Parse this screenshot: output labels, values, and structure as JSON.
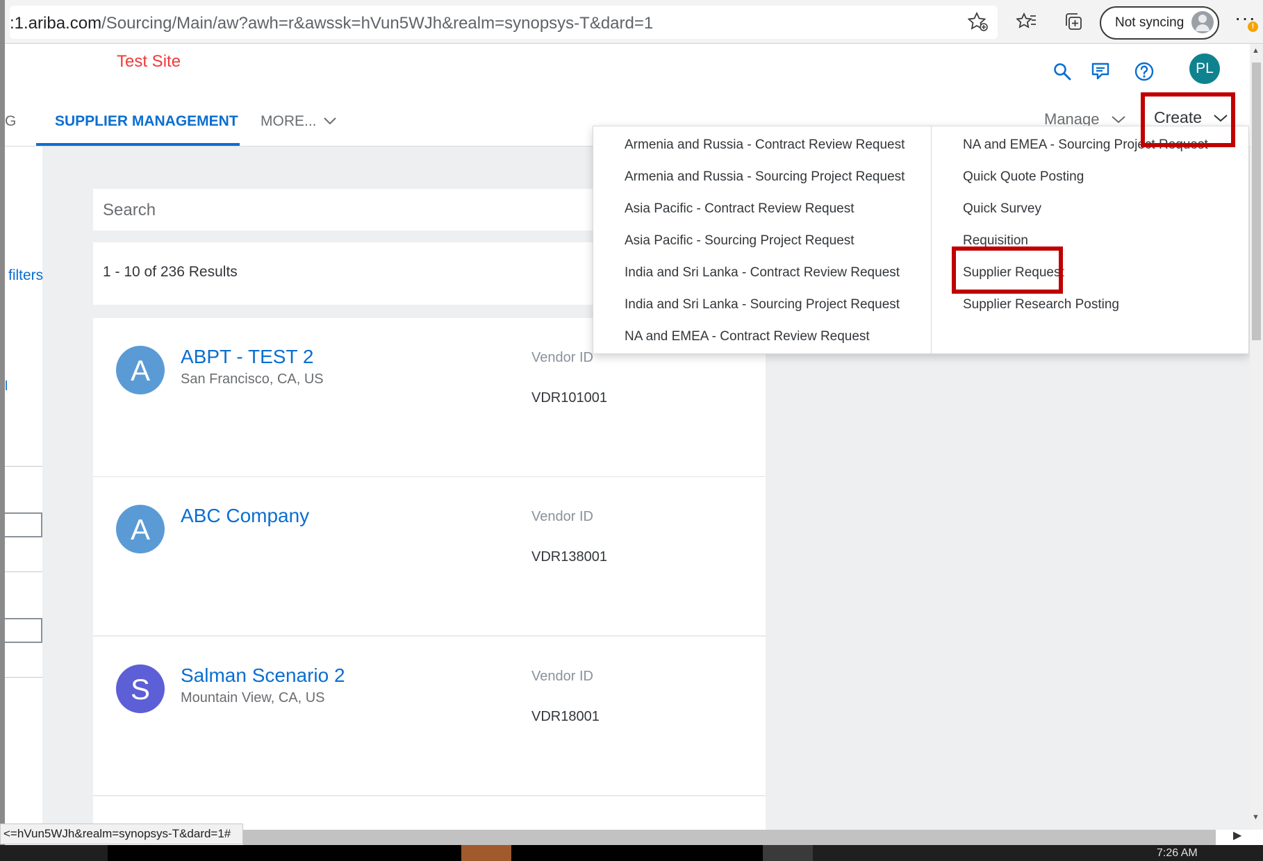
{
  "browser": {
    "url_prefix": ":1.ariba.com",
    "url_path": "/Sourcing/Main/aw?awh=r&awssk=hVun5WJh&realm=synopsys-T&dard=1",
    "sync_label": "Not syncing",
    "more_label": "···",
    "warn_badge": "!"
  },
  "header": {
    "site_label": "Test Site",
    "avatar_initials": "PL",
    "tabs": {
      "partial": "G",
      "active": "SUPPLIER MANAGEMENT",
      "more": "MORE..."
    },
    "manage_label": "Manage",
    "create_label": "Create"
  },
  "sidebar": {
    "filters_label": "filters",
    "mark": "l"
  },
  "search": {
    "placeholder": "Search"
  },
  "results": {
    "summary": "1 - 10 of 236 Results"
  },
  "cards": [
    {
      "initial": "A",
      "name": "ABPT - TEST 2",
      "location": "San Francisco, CA, US",
      "vendor_label": "Vendor ID",
      "vendor_id": "VDR101001",
      "color": "#5b9bd5"
    },
    {
      "initial": "A",
      "name": "ABC Company",
      "location": "",
      "vendor_label": "Vendor ID",
      "vendor_id": "VDR138001",
      "color": "#5b9bd5"
    },
    {
      "initial": "S",
      "name": "Salman Scenario 2",
      "location": "Mountain View, CA, US",
      "vendor_label": "Vendor ID",
      "vendor_id": "VDR18001",
      "color": "#5d5fd6"
    }
  ],
  "create_menu": {
    "left": [
      "Armenia and Russia - Contract Review Request",
      "Armenia and Russia - Sourcing Project Request",
      "Asia Pacific - Contract Review Request",
      "Asia Pacific - Sourcing Project Request",
      "India and Sri Lanka - Contract Review Request",
      "India and Sri Lanka - Sourcing Project Request",
      "NA and EMEA - Contract Review Request"
    ],
    "right": [
      "NA and EMEA - Sourcing Project Request",
      "Quick Quote Posting",
      "Quick Survey",
      "Requisition",
      "Supplier Request",
      "Supplier Research Posting"
    ]
  },
  "status_bar": {
    "text": "<=hVun5WJh&realm=synopsys-T&dard=1#"
  },
  "taskbar": {
    "clock": "7:26 AM"
  },
  "colors": {
    "accent": "#0a6ed1",
    "highlight": "#c00000",
    "site_label": "#ee3a3a"
  }
}
